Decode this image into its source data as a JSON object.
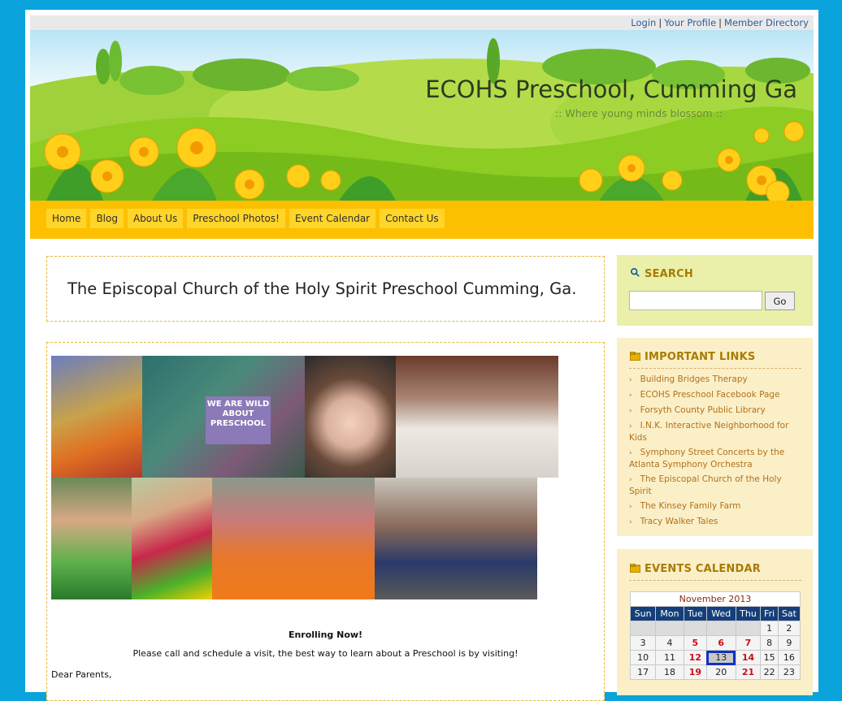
{
  "topbar": {
    "links": [
      "Login",
      "Your Profile",
      "Member Directory"
    ]
  },
  "header": {
    "title": "ECOHS Preschool, Cumming Ga",
    "tagline": ":: Where young minds blossom ::"
  },
  "nav": [
    "Home",
    "Blog",
    "About Us",
    "Preschool Photos!",
    "Event Calendar",
    "Contact Us"
  ],
  "main": {
    "title": "The Episcopal Church of the Holy Spirit Preschool Cumming, Ga.",
    "photo_sign": "WE ARE WILD ABOUT PRESCHOOL",
    "enrolling": "Enrolling Now!",
    "visit": "Please call and schedule a visit, the best way to learn about a Preschool is by visiting!",
    "dear": "Dear Parents,"
  },
  "sidebar": {
    "search": {
      "title": "SEARCH",
      "button": "Go",
      "placeholder": ""
    },
    "links": {
      "title": "IMPORTANT LINKS",
      "items": [
        "Building Bridges Therapy",
        "ECOHS Preschool Facebook Page",
        "Forsyth County Public Library",
        "I.N.K. Interactive Neighborhood for Kids",
        "Symphony Street Concerts by the Atlanta Symphony Orchestra",
        "The Episcopal Church of the Holy Spirit",
        "The Kinsey Family Farm",
        "Tracy Walker Tales"
      ]
    },
    "events": {
      "title": "EVENTS CALENDAR",
      "month": "November 2013",
      "days": [
        "Sun",
        "Mon",
        "Tue",
        "Wed",
        "Thu",
        "Fri",
        "Sat"
      ],
      "weeks": [
        [
          "",
          "",
          "",
          "",
          "",
          "1",
          "2"
        ],
        [
          "3",
          "4",
          "5",
          "6",
          "7",
          "8",
          "9"
        ],
        [
          "10",
          "11",
          "12",
          "13",
          "14",
          "15",
          "16"
        ],
        [
          "17",
          "18",
          "19",
          "20",
          "21",
          "22",
          "23"
        ]
      ],
      "event_days": [
        "5",
        "6",
        "7",
        "12",
        "14",
        "19",
        "21"
      ],
      "today": "13"
    }
  },
  "colors": {
    "frame": "#0aa3dc",
    "nav_bar": "#fdc000",
    "nav_button": "#ffd52a",
    "heading": "#a87b00",
    "link": "#b0711c",
    "calendar_header": "#153f7a"
  }
}
